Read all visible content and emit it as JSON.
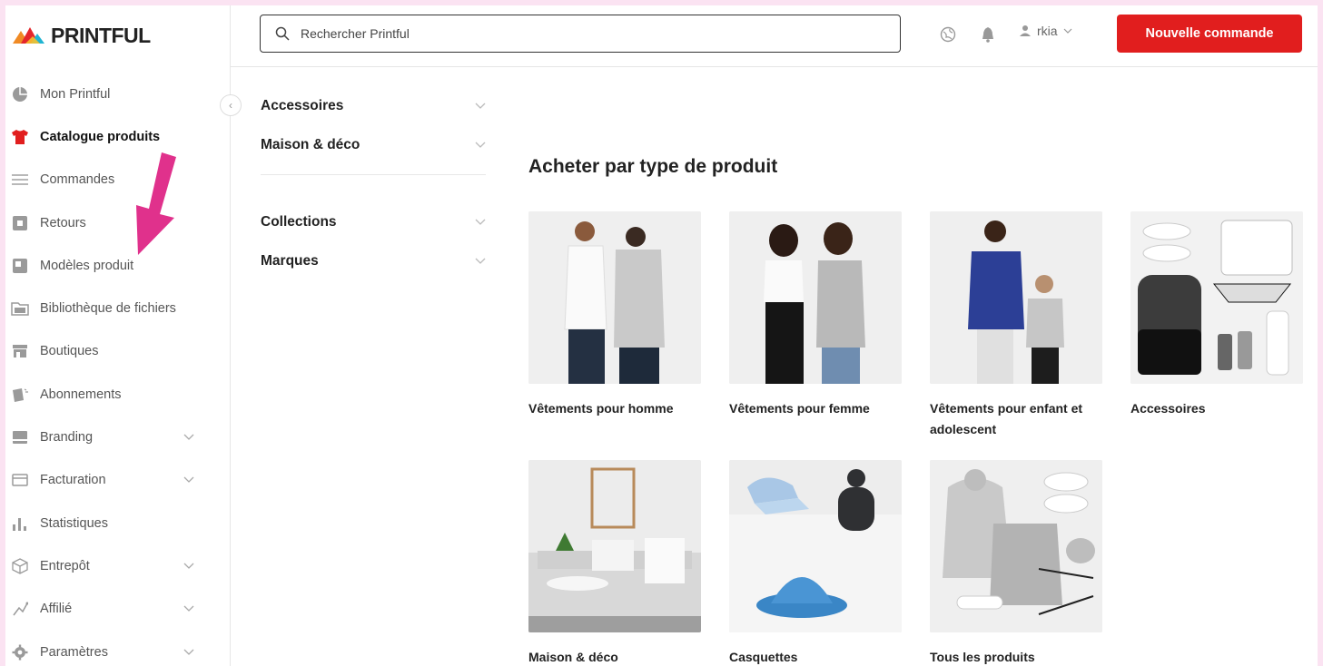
{
  "app": {
    "logo_text": "PRINTFUL"
  },
  "sidebar": {
    "items": [
      {
        "label": "Mon Printful",
        "icon": "pie-chart-icon",
        "active": false
      },
      {
        "label": "Catalogue produits",
        "icon": "tshirt-icon",
        "active": true
      },
      {
        "label": "Commandes",
        "icon": "list-icon",
        "active": false
      },
      {
        "label": "Retours",
        "icon": "return-box-icon",
        "active": false
      },
      {
        "label": "Modèles produit",
        "icon": "template-icon",
        "active": false
      },
      {
        "label": "Bibliothèque de fichiers",
        "icon": "folder-icon",
        "active": false
      },
      {
        "label": "Boutiques",
        "icon": "store-icon",
        "active": false
      },
      {
        "label": "Abonnements",
        "icon": "subscription-icon",
        "active": false
      },
      {
        "label": "Branding",
        "icon": "branding-icon",
        "active": false,
        "expandable": true
      },
      {
        "label": "Facturation",
        "icon": "card-icon",
        "active": false,
        "expandable": true
      },
      {
        "label": "Statistiques",
        "icon": "bar-chart-icon",
        "active": false
      },
      {
        "label": "Entrepôt",
        "icon": "box-icon",
        "active": false,
        "expandable": true
      },
      {
        "label": "Affilié",
        "icon": "affiliate-icon",
        "active": false,
        "expandable": true
      },
      {
        "label": "Paramètres",
        "icon": "gear-icon",
        "active": false,
        "expandable": true
      }
    ]
  },
  "header": {
    "search_placeholder": "Rechercher Printful",
    "username": "rkia",
    "new_order_label": "Nouvelle commande"
  },
  "category_menu": {
    "group1": [
      "Accessoires",
      "Maison & déco"
    ],
    "group2": [
      "Collections",
      "Marques"
    ]
  },
  "main": {
    "heading": "Acheter par type de produit",
    "cards": [
      {
        "label": "Vêtements pour homme",
        "image": "men-clothing-image"
      },
      {
        "label": "Vêtements pour femme",
        "image": "women-clothing-image"
      },
      {
        "label": "Vêtements pour enfant et adolescent",
        "image": "kids-clothing-image"
      },
      {
        "label": "Accessoires",
        "image": "accessories-image"
      },
      {
        "label": "Maison & déco",
        "image": "home-decor-image"
      },
      {
        "label": "Casquettes",
        "image": "hats-image"
      },
      {
        "label": "Tous les produits",
        "image": "all-products-image"
      }
    ]
  },
  "colors": {
    "accent": "#e11e1e",
    "annotation_arrow": "#e0318c",
    "page_border": "#fbe3f2"
  }
}
